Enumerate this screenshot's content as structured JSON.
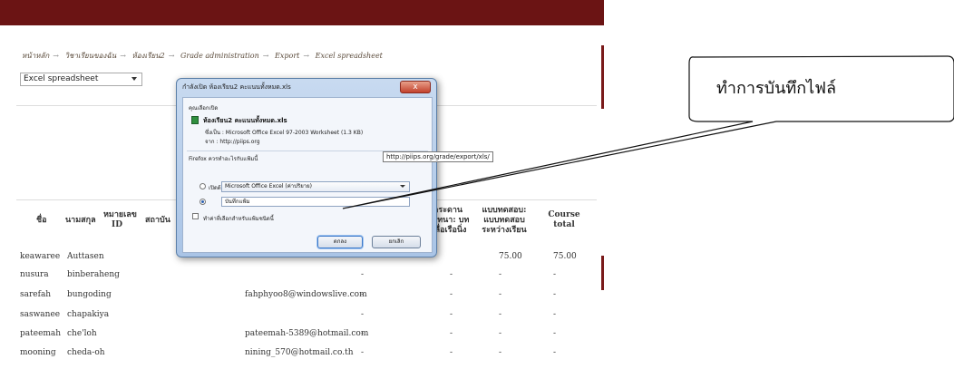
{
  "breadcrumb": [
    "หน้าหลัก",
    "วิชาเรียนของฉัน",
    "ห้องเรียน2",
    "Grade administration",
    "Export",
    "Excel spreadsheet"
  ],
  "breadcrumb_sep": "→",
  "format_select": {
    "value": "Excel spreadsheet"
  },
  "table": {
    "headers": {
      "firstname": "ชื่อ",
      "lastname": "นามสกุล",
      "idnumber": "หมายเลข ID",
      "institution": "สถาบัน",
      "quiz1": "กระดานสนทนา: บทคลื่อเรือนิ่ง",
      "quiz2": "แบบทดสอบ: แบบทดสอบระหว่างเรียน",
      "course_total": "Course total"
    },
    "rows": [
      {
        "first": "keawaree",
        "last": "Auttasen",
        "email": "",
        "c1": "-",
        "c2": "-",
        "c3": "75.00",
        "total": "75.00"
      },
      {
        "first": "nusura",
        "last": "binberaheng",
        "email": "",
        "c1": "-",
        "c2": "-",
        "c3": "-",
        "total": "-"
      },
      {
        "first": "sarefah",
        "last": "bungoding",
        "email": "fahphyoo8@windowslive.com",
        "c1": "-",
        "c2": "-",
        "c3": "-",
        "total": "-"
      },
      {
        "first": "saswanee",
        "last": "chapakiya",
        "email": "",
        "c1": "-",
        "c2": "-",
        "c3": "-",
        "total": "-"
      },
      {
        "first": "pateemah",
        "last": "che'loh",
        "email": "pateemah-5389@hotmail.com",
        "c1": "-",
        "c2": "-",
        "c3": "-",
        "total": "-"
      },
      {
        "first": "mooning",
        "last": "cheda-oh",
        "email": "nining_570@hotmail.co.th",
        "c1": "-",
        "c2": "-",
        "c3": "-",
        "total": "-"
      }
    ]
  },
  "dialog": {
    "title": "กำลังเปิด ห้องเรียน2 คะแนนทั้งหมด.xls",
    "close_label": "x",
    "open_prompt": "คุณเลือกเปิด",
    "file_name": "ห้องเรียน2 คะแนนทั้งหมด.xls",
    "file_type_label": "ซึ่งเป็น : Microsoft Office Excel 97-2003 Worksheet (1.3 KB)",
    "file_from_label": "จาก : http://piips.org",
    "action_prompt": "Firefox ควรทำอะไรกับแฟ้มนี้",
    "open_with_label": "เปิดด้วย",
    "open_with_app": "Microsoft Office Excel (ค่าปริยาย)",
    "save_label": "บันทึกแฟ้ม",
    "remember_label": "ทำค่าที่เลือกสำหรับแฟ้มชนิดนี้",
    "ok_label": "ตกลง",
    "cancel_label": "ยกเลิก",
    "selected_option": "save"
  },
  "tooltip": "http://piips.org/grade/export/xls/",
  "callout": "ทำการบันทึกไฟล์"
}
